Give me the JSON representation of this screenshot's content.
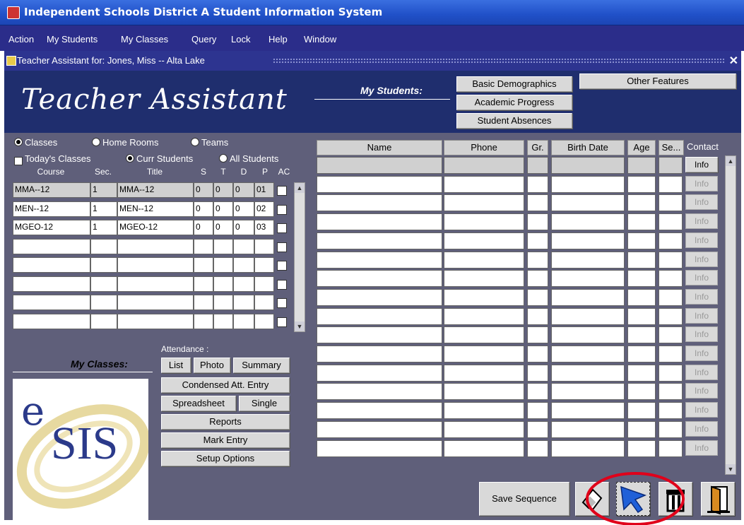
{
  "window": {
    "title": "Independent Schools District A Student Information System"
  },
  "menu": [
    "Action",
    "My Students",
    "My Classes",
    "Query",
    "Lock",
    "Help",
    "Window"
  ],
  "inner_window": {
    "title": "Teacher Assistant for: Jones, Miss -- Alta Lake",
    "close": "✕"
  },
  "header": {
    "title": "Teacher Assistant",
    "my_students_label": "My Students:",
    "buttons": [
      "Basic Demographics",
      "Academic Progress",
      "Student Absences"
    ],
    "other_features": "Other Features"
  },
  "filters": {
    "radio1": [
      {
        "label": "Classes",
        "selected": true
      },
      {
        "label": "Home Rooms",
        "selected": false
      },
      {
        "label": "Teams",
        "selected": false
      }
    ],
    "todays_classes": {
      "label": "Today's Classes",
      "checked": true
    },
    "radio2": [
      {
        "label": "Curr Students",
        "selected": true
      },
      {
        "label": "All Students",
        "selected": false
      }
    ]
  },
  "classes_table": {
    "headers": [
      "Course",
      "Sec.",
      "Title",
      "S",
      "T",
      "D",
      "P",
      "AC"
    ],
    "rows": [
      {
        "course": "MMA--12",
        "sec": "1",
        "title": "MMA--12",
        "s": "0",
        "t": "0",
        "d": "0",
        "p": "01"
      },
      {
        "course": "MEN--12",
        "sec": "1",
        "title": "MEN--12",
        "s": "0",
        "t": "0",
        "d": "0",
        "p": "02"
      },
      {
        "course": "MGEO-12",
        "sec": "1",
        "title": "MGEO-12",
        "s": "0",
        "t": "0",
        "d": "0",
        "p": "03"
      }
    ],
    "empty_rows": 5
  },
  "attendance": {
    "label": "Attendance :",
    "my_classes_label": "My Classes:",
    "buttons": {
      "list": "List",
      "photo": "Photo",
      "summary": "Summary",
      "condensed": "Condensed Att. Entry",
      "spreadsheet": "Spreadsheet",
      "single": "Single",
      "reports": "Reports",
      "mark_entry": "Mark Entry",
      "setup": "Setup Options"
    }
  },
  "logo": {
    "text_e": "e",
    "text_sis": "SIS"
  },
  "students_table": {
    "headers": [
      "Name",
      "Phone",
      "Gr.",
      "Birth Date",
      "Age",
      "Se...",
      "Contact"
    ],
    "row_count": 16,
    "info_label": "Info"
  },
  "toolbar": {
    "save_sequence": "Save Sequence"
  },
  "colors": {
    "title_bar": "#2050c8",
    "menu_bar": "#2b2d8a",
    "header_bg": "#1f2e6e",
    "body_bg": "#5f5f7a",
    "highlight_circle": "#e0001a"
  }
}
